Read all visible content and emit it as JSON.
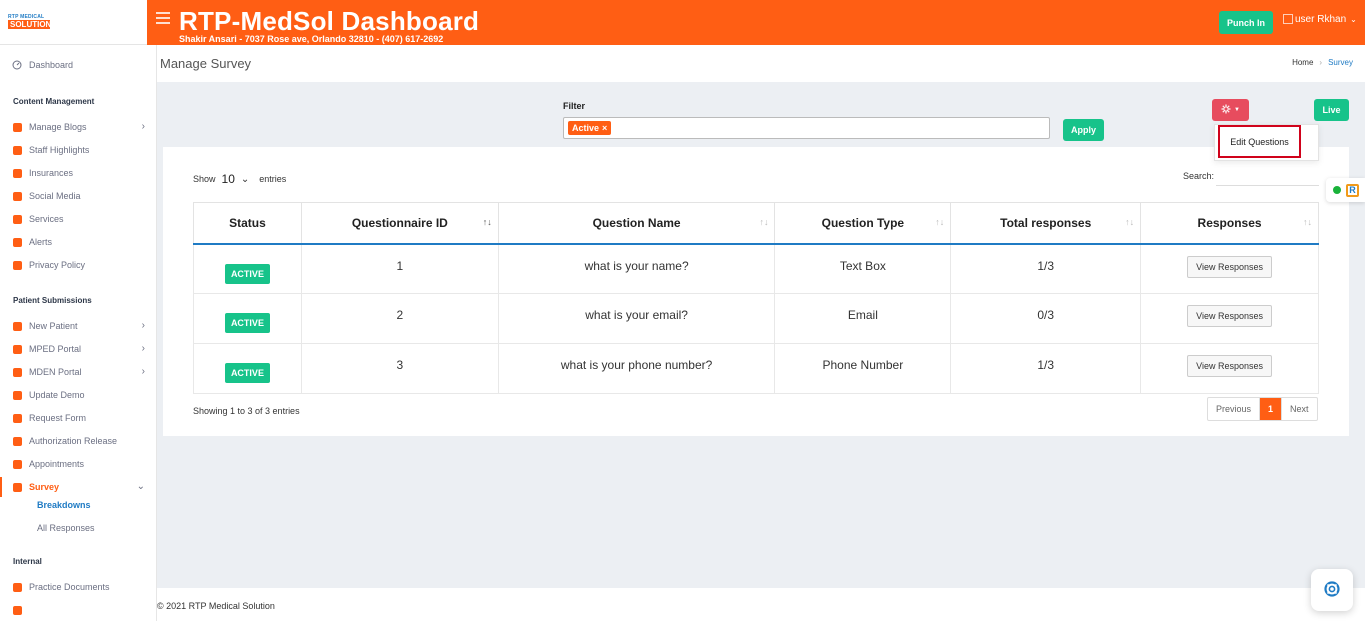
{
  "brand": {
    "logo_line1": "RTP MEDICAL",
    "logo_line2": "SOLUTION"
  },
  "header": {
    "title": "RTP-MedSol Dashboard",
    "subtitle": "Shakir Ansari - 7037 Rose ave, Orlando 32810 - (407) 617-2692",
    "punch_label": "Punch In",
    "user_label": "user Rkhan"
  },
  "sidebar": {
    "dashboard": "Dashboard",
    "section_content": "Content Management",
    "content_items": [
      "Manage Blogs",
      "Staff Highlights",
      "Insurances",
      "Social Media",
      "Services",
      "Alerts",
      "Privacy Policy"
    ],
    "section_patient": "Patient Submissions",
    "patient_items": [
      "New Patient",
      "MPED Portal",
      "MDEN Portal",
      "Update Demo",
      "Request Form",
      "Authorization Release",
      "Appointments",
      "Survey"
    ],
    "survey_sub": [
      "Breakdowns",
      "All Responses"
    ],
    "section_internal": "Internal",
    "internal_items": [
      "Practice Documents"
    ]
  },
  "page": {
    "title": "Manage Survey",
    "breadcrumb_home": "Home",
    "breadcrumb_current": "Survey"
  },
  "filter": {
    "label": "Filter",
    "chip": "Active",
    "chip_remove": "×",
    "apply_label": "Apply"
  },
  "actions": {
    "live_label": "Live",
    "dropdown_item": "Edit Questions"
  },
  "table_controls": {
    "show_label": "Show",
    "page_size": "10",
    "entries_label": "entries",
    "search_label": "Search:"
  },
  "table": {
    "columns": [
      "Status",
      "Questionnaire ID",
      "Question Name",
      "Question Type",
      "Total responses",
      "Responses"
    ],
    "rows": [
      {
        "status": "ACTIVE",
        "id": "1",
        "name": "what is your name?",
        "type": "Text Box",
        "total": "1/3",
        "action": "View Responses"
      },
      {
        "status": "ACTIVE",
        "id": "2",
        "name": "what is your email?",
        "type": "Email",
        "total": "0/3",
        "action": "View Responses"
      },
      {
        "status": "ACTIVE",
        "id": "3",
        "name": "what is your phone number?",
        "type": "Phone Number",
        "total": "1/3",
        "action": "View Responses"
      }
    ]
  },
  "pagination": {
    "info": "Showing 1 to 3 of 3 entries",
    "previous": "Previous",
    "current": "1",
    "next": "Next"
  },
  "footer": {
    "copyright": "© 2021 RTP Medical Solution"
  },
  "colors": {
    "brand_orange": "#ff5e14",
    "green": "#17c38a",
    "blue": "#1f7bc4",
    "red_btn": "#e74c5e"
  }
}
